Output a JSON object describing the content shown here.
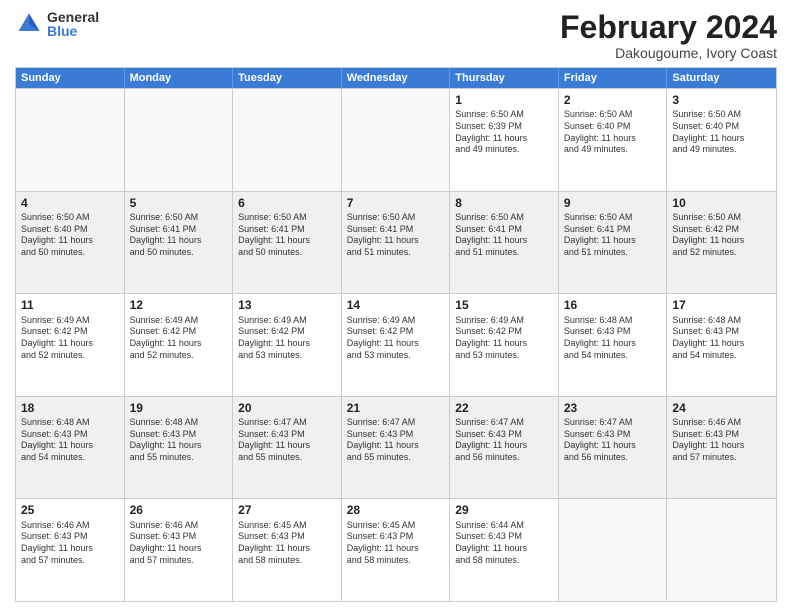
{
  "logo": {
    "general": "General",
    "blue": "Blue"
  },
  "title": "February 2024",
  "location": "Dakougoume, Ivory Coast",
  "header": {
    "days": [
      "Sunday",
      "Monday",
      "Tuesday",
      "Wednesday",
      "Thursday",
      "Friday",
      "Saturday"
    ]
  },
  "rows": [
    [
      {
        "day": "",
        "empty": true
      },
      {
        "day": "",
        "empty": true
      },
      {
        "day": "",
        "empty": true
      },
      {
        "day": "",
        "empty": true
      },
      {
        "day": "1",
        "lines": [
          "Sunrise: 6:50 AM",
          "Sunset: 6:39 PM",
          "Daylight: 11 hours",
          "and 49 minutes."
        ]
      },
      {
        "day": "2",
        "lines": [
          "Sunrise: 6:50 AM",
          "Sunset: 6:40 PM",
          "Daylight: 11 hours",
          "and 49 minutes."
        ]
      },
      {
        "day": "3",
        "lines": [
          "Sunrise: 6:50 AM",
          "Sunset: 6:40 PM",
          "Daylight: 11 hours",
          "and 49 minutes."
        ]
      }
    ],
    [
      {
        "day": "4",
        "lines": [
          "Sunrise: 6:50 AM",
          "Sunset: 6:40 PM",
          "Daylight: 11 hours",
          "and 50 minutes."
        ]
      },
      {
        "day": "5",
        "lines": [
          "Sunrise: 6:50 AM",
          "Sunset: 6:41 PM",
          "Daylight: 11 hours",
          "and 50 minutes."
        ]
      },
      {
        "day": "6",
        "lines": [
          "Sunrise: 6:50 AM",
          "Sunset: 6:41 PM",
          "Daylight: 11 hours",
          "and 50 minutes."
        ]
      },
      {
        "day": "7",
        "lines": [
          "Sunrise: 6:50 AM",
          "Sunset: 6:41 PM",
          "Daylight: 11 hours",
          "and 51 minutes."
        ]
      },
      {
        "day": "8",
        "lines": [
          "Sunrise: 6:50 AM",
          "Sunset: 6:41 PM",
          "Daylight: 11 hours",
          "and 51 minutes."
        ]
      },
      {
        "day": "9",
        "lines": [
          "Sunrise: 6:50 AM",
          "Sunset: 6:41 PM",
          "Daylight: 11 hours",
          "and 51 minutes."
        ]
      },
      {
        "day": "10",
        "lines": [
          "Sunrise: 6:50 AM",
          "Sunset: 6:42 PM",
          "Daylight: 11 hours",
          "and 52 minutes."
        ]
      }
    ],
    [
      {
        "day": "11",
        "lines": [
          "Sunrise: 6:49 AM",
          "Sunset: 6:42 PM",
          "Daylight: 11 hours",
          "and 52 minutes."
        ]
      },
      {
        "day": "12",
        "lines": [
          "Sunrise: 6:49 AM",
          "Sunset: 6:42 PM",
          "Daylight: 11 hours",
          "and 52 minutes."
        ]
      },
      {
        "day": "13",
        "lines": [
          "Sunrise: 6:49 AM",
          "Sunset: 6:42 PM",
          "Daylight: 11 hours",
          "and 53 minutes."
        ]
      },
      {
        "day": "14",
        "lines": [
          "Sunrise: 6:49 AM",
          "Sunset: 6:42 PM",
          "Daylight: 11 hours",
          "and 53 minutes."
        ]
      },
      {
        "day": "15",
        "lines": [
          "Sunrise: 6:49 AM",
          "Sunset: 6:42 PM",
          "Daylight: 11 hours",
          "and 53 minutes."
        ]
      },
      {
        "day": "16",
        "lines": [
          "Sunrise: 6:48 AM",
          "Sunset: 6:43 PM",
          "Daylight: 11 hours",
          "and 54 minutes."
        ]
      },
      {
        "day": "17",
        "lines": [
          "Sunrise: 6:48 AM",
          "Sunset: 6:43 PM",
          "Daylight: 11 hours",
          "and 54 minutes."
        ]
      }
    ],
    [
      {
        "day": "18",
        "lines": [
          "Sunrise: 6:48 AM",
          "Sunset: 6:43 PM",
          "Daylight: 11 hours",
          "and 54 minutes."
        ]
      },
      {
        "day": "19",
        "lines": [
          "Sunrise: 6:48 AM",
          "Sunset: 6:43 PM",
          "Daylight: 11 hours",
          "and 55 minutes."
        ]
      },
      {
        "day": "20",
        "lines": [
          "Sunrise: 6:47 AM",
          "Sunset: 6:43 PM",
          "Daylight: 11 hours",
          "and 55 minutes."
        ]
      },
      {
        "day": "21",
        "lines": [
          "Sunrise: 6:47 AM",
          "Sunset: 6:43 PM",
          "Daylight: 11 hours",
          "and 55 minutes."
        ]
      },
      {
        "day": "22",
        "lines": [
          "Sunrise: 6:47 AM",
          "Sunset: 6:43 PM",
          "Daylight: 11 hours",
          "and 56 minutes."
        ]
      },
      {
        "day": "23",
        "lines": [
          "Sunrise: 6:47 AM",
          "Sunset: 6:43 PM",
          "Daylight: 11 hours",
          "and 56 minutes."
        ]
      },
      {
        "day": "24",
        "lines": [
          "Sunrise: 6:46 AM",
          "Sunset: 6:43 PM",
          "Daylight: 11 hours",
          "and 57 minutes."
        ]
      }
    ],
    [
      {
        "day": "25",
        "lines": [
          "Sunrise: 6:46 AM",
          "Sunset: 6:43 PM",
          "Daylight: 11 hours",
          "and 57 minutes."
        ]
      },
      {
        "day": "26",
        "lines": [
          "Sunrise: 6:46 AM",
          "Sunset: 6:43 PM",
          "Daylight: 11 hours",
          "and 57 minutes."
        ]
      },
      {
        "day": "27",
        "lines": [
          "Sunrise: 6:45 AM",
          "Sunset: 6:43 PM",
          "Daylight: 11 hours",
          "and 58 minutes."
        ]
      },
      {
        "day": "28",
        "lines": [
          "Sunrise: 6:45 AM",
          "Sunset: 6:43 PM",
          "Daylight: 11 hours",
          "and 58 minutes."
        ]
      },
      {
        "day": "29",
        "lines": [
          "Sunrise: 6:44 AM",
          "Sunset: 6:43 PM",
          "Daylight: 11 hours",
          "and 58 minutes."
        ]
      },
      {
        "day": "",
        "empty": true
      },
      {
        "day": "",
        "empty": true
      }
    ]
  ]
}
